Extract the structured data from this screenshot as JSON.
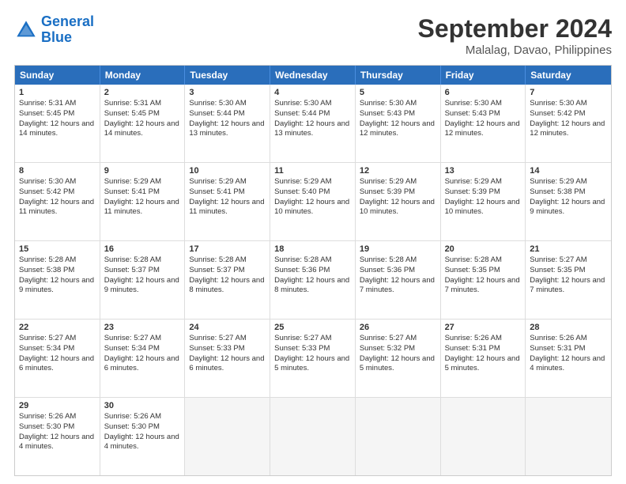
{
  "logo": {
    "line1": "General",
    "line2": "Blue"
  },
  "header": {
    "month": "September 2024",
    "location": "Malalag, Davao, Philippines"
  },
  "days": [
    "Sunday",
    "Monday",
    "Tuesday",
    "Wednesday",
    "Thursday",
    "Friday",
    "Saturday"
  ],
  "rows": [
    [
      {
        "day": "1",
        "rise": "5:31 AM",
        "set": "5:45 PM",
        "daylight": "12 hours and 14 minutes."
      },
      {
        "day": "2",
        "rise": "5:31 AM",
        "set": "5:45 PM",
        "daylight": "12 hours and 14 minutes."
      },
      {
        "day": "3",
        "rise": "5:30 AM",
        "set": "5:44 PM",
        "daylight": "12 hours and 13 minutes."
      },
      {
        "day": "4",
        "rise": "5:30 AM",
        "set": "5:44 PM",
        "daylight": "12 hours and 13 minutes."
      },
      {
        "day": "5",
        "rise": "5:30 AM",
        "set": "5:43 PM",
        "daylight": "12 hours and 12 minutes."
      },
      {
        "day": "6",
        "rise": "5:30 AM",
        "set": "5:43 PM",
        "daylight": "12 hours and 12 minutes."
      },
      {
        "day": "7",
        "rise": "5:30 AM",
        "set": "5:42 PM",
        "daylight": "12 hours and 12 minutes."
      }
    ],
    [
      {
        "day": "8",
        "rise": "5:30 AM",
        "set": "5:42 PM",
        "daylight": "12 hours and 11 minutes."
      },
      {
        "day": "9",
        "rise": "5:29 AM",
        "set": "5:41 PM",
        "daylight": "12 hours and 11 minutes."
      },
      {
        "day": "10",
        "rise": "5:29 AM",
        "set": "5:41 PM",
        "daylight": "12 hours and 11 minutes."
      },
      {
        "day": "11",
        "rise": "5:29 AM",
        "set": "5:40 PM",
        "daylight": "12 hours and 10 minutes."
      },
      {
        "day": "12",
        "rise": "5:29 AM",
        "set": "5:39 PM",
        "daylight": "12 hours and 10 minutes."
      },
      {
        "day": "13",
        "rise": "5:29 AM",
        "set": "5:39 PM",
        "daylight": "12 hours and 10 minutes."
      },
      {
        "day": "14",
        "rise": "5:29 AM",
        "set": "5:38 PM",
        "daylight": "12 hours and 9 minutes."
      }
    ],
    [
      {
        "day": "15",
        "rise": "5:28 AM",
        "set": "5:38 PM",
        "daylight": "12 hours and 9 minutes."
      },
      {
        "day": "16",
        "rise": "5:28 AM",
        "set": "5:37 PM",
        "daylight": "12 hours and 9 minutes."
      },
      {
        "day": "17",
        "rise": "5:28 AM",
        "set": "5:37 PM",
        "daylight": "12 hours and 8 minutes."
      },
      {
        "day": "18",
        "rise": "5:28 AM",
        "set": "5:36 PM",
        "daylight": "12 hours and 8 minutes."
      },
      {
        "day": "19",
        "rise": "5:28 AM",
        "set": "5:36 PM",
        "daylight": "12 hours and 7 minutes."
      },
      {
        "day": "20",
        "rise": "5:28 AM",
        "set": "5:35 PM",
        "daylight": "12 hours and 7 minutes."
      },
      {
        "day": "21",
        "rise": "5:27 AM",
        "set": "5:35 PM",
        "daylight": "12 hours and 7 minutes."
      }
    ],
    [
      {
        "day": "22",
        "rise": "5:27 AM",
        "set": "5:34 PM",
        "daylight": "12 hours and 6 minutes."
      },
      {
        "day": "23",
        "rise": "5:27 AM",
        "set": "5:34 PM",
        "daylight": "12 hours and 6 minutes."
      },
      {
        "day": "24",
        "rise": "5:27 AM",
        "set": "5:33 PM",
        "daylight": "12 hours and 6 minutes."
      },
      {
        "day": "25",
        "rise": "5:27 AM",
        "set": "5:33 PM",
        "daylight": "12 hours and 5 minutes."
      },
      {
        "day": "26",
        "rise": "5:27 AM",
        "set": "5:32 PM",
        "daylight": "12 hours and 5 minutes."
      },
      {
        "day": "27",
        "rise": "5:26 AM",
        "set": "5:31 PM",
        "daylight": "12 hours and 5 minutes."
      },
      {
        "day": "28",
        "rise": "5:26 AM",
        "set": "5:31 PM",
        "daylight": "12 hours and 4 minutes."
      }
    ],
    [
      {
        "day": "29",
        "rise": "5:26 AM",
        "set": "5:30 PM",
        "daylight": "12 hours and 4 minutes."
      },
      {
        "day": "30",
        "rise": "5:26 AM",
        "set": "5:30 PM",
        "daylight": "12 hours and 4 minutes."
      },
      null,
      null,
      null,
      null,
      null
    ]
  ]
}
